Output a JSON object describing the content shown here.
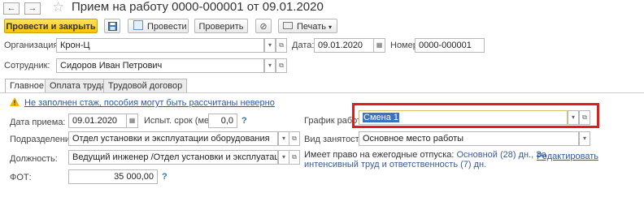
{
  "window": {
    "title": "Прием на работу 0000-000001 от 09.01.2020",
    "nav_back": "←",
    "nav_forward": "→"
  },
  "toolbar": {
    "post_and_close": "Провести и закрыть",
    "post": "Провести",
    "check": "Проверить",
    "print": "Печать"
  },
  "header": {
    "organization_label": "Организация:",
    "organization_value": "Крон-Ц",
    "date_label": "Дата:",
    "date_value": "09.01.2020",
    "number_label": "Номер:",
    "number_value": "0000-000001",
    "employee_label": "Сотрудник:",
    "employee_value": "Сидоров Иван Петрович"
  },
  "tabs": [
    {
      "label": "Главное",
      "active": true
    },
    {
      "label": "Оплата труда",
      "active": false
    },
    {
      "label": "Трудовой договор",
      "active": false
    }
  ],
  "warning": {
    "text": "Не заполнен стаж, пособия могут быть рассчитаны неверно",
    "color": "#e8a400"
  },
  "main": {
    "hire_date_label": "Дата приема:",
    "hire_date_value": "09.01.2020",
    "probation_label": "Испыт. срок (мес):",
    "probation_value": "0,0",
    "schedule_label": "График работы:",
    "schedule_value": "Смена 1",
    "department_label": "Подразделение:",
    "department_value": "Отдел установки и эксплуатации оборудования",
    "employment_type_label": "Вид занятости:",
    "employment_type_value": "Основное место работы",
    "position_label": "Должность:",
    "position_value": "Ведущий инженер /Отдел установки и эксплуатации оборуд",
    "vacation_prefix": "Имеет право на ежегодные отпуска:",
    "vacation_line1": "Основной (28) дн., За",
    "vacation_line2": "интенсивный труд и ответственность (7) дн.",
    "edit_link": "Редактировать",
    "fot_label": "ФОТ:",
    "fot_value": "35 000,00",
    "help_mark": "?"
  },
  "colors": {
    "accent_yellow": "#f6c500",
    "highlight_red": "#e21c1c",
    "link_blue": "#2b5aa3"
  }
}
